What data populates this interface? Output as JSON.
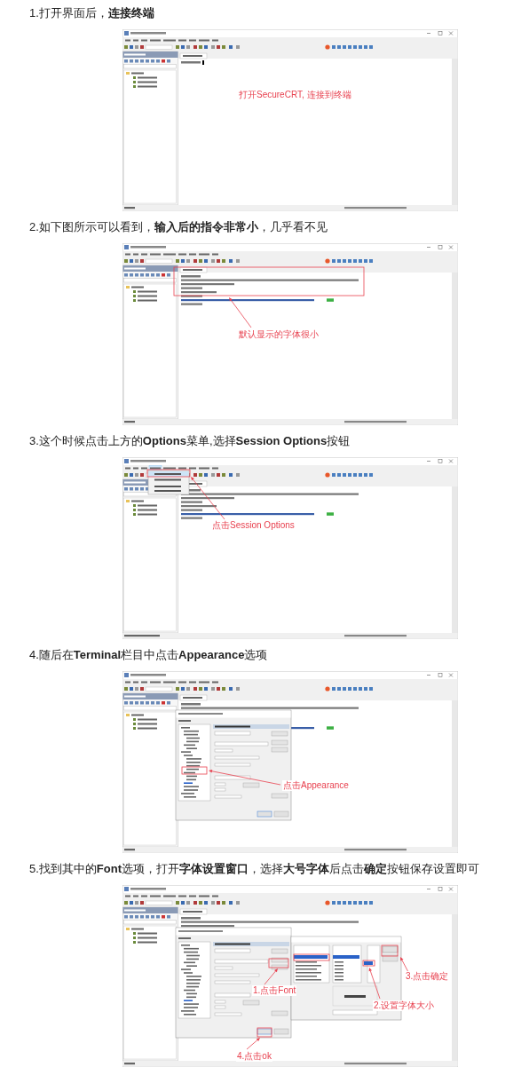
{
  "steps": [
    {
      "heading": "1.打开界面后，**连接终端**",
      "screenshot": {
        "options_menu_open": false,
        "terminal_output": false,
        "dialog": false,
        "font_dialog": false,
        "annotations": [
          "打开SecureCRT, 连接到终端"
        ]
      }
    },
    {
      "heading": "2.如下图所示可以看到，**输入后的指令非常小**，几乎看不见",
      "screenshot": {
        "options_menu_open": false,
        "terminal_output": true,
        "dialog": false,
        "font_dialog": false,
        "annotations": [
          "默认显示的字体很小"
        ]
      }
    },
    {
      "heading": "3.这个时候点击上方的**Options**菜单,选择**Session Options**按钮",
      "screenshot": {
        "options_menu_open": true,
        "terminal_output": true,
        "dialog": false,
        "font_dialog": false,
        "annotations": [
          "点击Session Options"
        ]
      }
    },
    {
      "heading": "4.随后在**Terminal**栏目中点击**Appearance**选项",
      "screenshot": {
        "options_menu_open": false,
        "terminal_output": true,
        "dialog": true,
        "font_dialog": false,
        "annotations": [
          "点击Appearance"
        ]
      }
    },
    {
      "heading": "5.找到其中的**Font**选项，打开**字体设置窗口**，选择**大号字体**后点击**确定**按钮保存设置即可",
      "screenshot": {
        "options_menu_open": false,
        "terminal_output": true,
        "dialog": true,
        "font_dialog": true,
        "annotations": [
          "3.点击确定",
          "1.点击Font",
          "2.设置字体大小",
          "4.点击ok"
        ]
      }
    }
  ]
}
